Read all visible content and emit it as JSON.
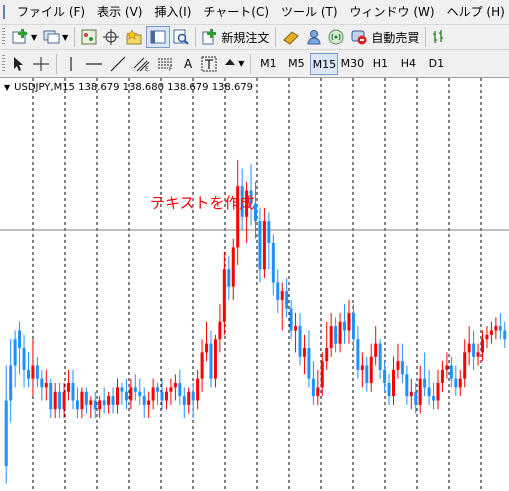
{
  "menu": {
    "items": [
      "ファイル (F)",
      "表示 (V)",
      "挿入(I)",
      "チャート(C)",
      "ツール (T)",
      "ウィンドウ (W)",
      "ヘルプ (H)"
    ]
  },
  "toolbar": {
    "new_order_label": "新規注文",
    "auto_trade_label": "自動売買"
  },
  "drawing_tools": {
    "text_tool_label": "A"
  },
  "timeframes": {
    "items": [
      "M1",
      "M5",
      "M15",
      "M30",
      "H1",
      "H4",
      "D1"
    ],
    "active": "M15"
  },
  "chart": {
    "header_text": "USDJPY,M15  138.679 138.680 138.679 138.679",
    "text_object": "テキストを作成",
    "colors": {
      "bull": "#ff0000",
      "bear": "#1e90ff",
      "grid": "#000000",
      "hline": "#808080"
    }
  },
  "chart_data": {
    "type": "candlestick",
    "symbol": "USDJPY",
    "timeframe": "M15",
    "grid": true,
    "scale_note": "relative price units, higher = higher price",
    "candles": [
      [
        290,
        306,
        260,
        252
      ],
      [
        306,
        318,
        290,
        280
      ],
      [
        318,
        322,
        306,
        296
      ],
      [
        322,
        326,
        314,
        302
      ],
      [
        314,
        320,
        304,
        296
      ],
      [
        304,
        312,
        300,
        296
      ],
      [
        300,
        318,
        306,
        292
      ],
      [
        306,
        310,
        300,
        296
      ],
      [
        300,
        304,
        296,
        290
      ],
      [
        296,
        304,
        298,
        290
      ],
      [
        298,
        300,
        286,
        282
      ],
      [
        286,
        298,
        294,
        282
      ],
      [
        294,
        298,
        286,
        282
      ],
      [
        286,
        298,
        294,
        282
      ],
      [
        294,
        304,
        298,
        290
      ],
      [
        298,
        304,
        290,
        286
      ],
      [
        290,
        296,
        286,
        282
      ],
      [
        286,
        296,
        294,
        282
      ],
      [
        294,
        296,
        288,
        284
      ],
      [
        288,
        292,
        290,
        282
      ],
      [
        290,
        294,
        286,
        282
      ],
      [
        286,
        292,
        290,
        282
      ],
      [
        290,
        296,
        288,
        284
      ],
      [
        288,
        294,
        292,
        284
      ],
      [
        292,
        296,
        288,
        284
      ],
      [
        288,
        300,
        296,
        284
      ],
      [
        296,
        298,
        294,
        288
      ],
      [
        294,
        300,
        290,
        286
      ],
      [
        290,
        300,
        296,
        286
      ],
      [
        296,
        302,
        294,
        290
      ],
      [
        294,
        300,
        292,
        288
      ],
      [
        292,
        296,
        288,
        282
      ],
      [
        288,
        294,
        290,
        282
      ],
      [
        290,
        300,
        296,
        286
      ],
      [
        296,
        298,
        294,
        288
      ],
      [
        294,
        300,
        290,
        286
      ],
      [
        290,
        296,
        294,
        286
      ],
      [
        294,
        300,
        296,
        288
      ],
      [
        296,
        302,
        298,
        290
      ],
      [
        298,
        304,
        292,
        288
      ],
      [
        292,
        296,
        288,
        282
      ],
      [
        288,
        296,
        294,
        284
      ],
      [
        294,
        298,
        290,
        282
      ],
      [
        290,
        304,
        300,
        286
      ],
      [
        300,
        318,
        312,
        294
      ],
      [
        312,
        326,
        316,
        308
      ],
      [
        316,
        322,
        300,
        296
      ],
      [
        300,
        320,
        318,
        296
      ],
      [
        318,
        334,
        326,
        312
      ],
      [
        326,
        358,
        350,
        320
      ],
      [
        350,
        356,
        342,
        336
      ],
      [
        342,
        364,
        360,
        336
      ],
      [
        360,
        400,
        388,
        352
      ],
      [
        388,
        396,
        374,
        368
      ],
      [
        374,
        390,
        386,
        362
      ],
      [
        386,
        398,
        380,
        370
      ],
      [
        380,
        390,
        372,
        364
      ],
      [
        372,
        378,
        350,
        344
      ],
      [
        350,
        378,
        372,
        346
      ],
      [
        372,
        376,
        362,
        350
      ],
      [
        362,
        366,
        344,
        338
      ],
      [
        344,
        350,
        336,
        330
      ],
      [
        336,
        344,
        340,
        322
      ],
      [
        340,
        346,
        332,
        328
      ],
      [
        332,
        336,
        322,
        318
      ],
      [
        322,
        330,
        324,
        312
      ],
      [
        324,
        330,
        310,
        306
      ],
      [
        310,
        320,
        314,
        302
      ],
      [
        314,
        322,
        300,
        296
      ],
      [
        300,
        308,
        292,
        288
      ],
      [
        292,
        304,
        296,
        288
      ],
      [
        296,
        312,
        308,
        292
      ],
      [
        308,
        326,
        314,
        304
      ],
      [
        314,
        330,
        324,
        310
      ],
      [
        324,
        328,
        316,
        312
      ],
      [
        316,
        330,
        326,
        312
      ],
      [
        326,
        334,
        322,
        316
      ],
      [
        322,
        336,
        330,
        316
      ],
      [
        330,
        334,
        318,
        314
      ],
      [
        318,
        324,
        304,
        300
      ],
      [
        304,
        312,
        306,
        296
      ],
      [
        306,
        310,
        298,
        294
      ],
      [
        298,
        316,
        310,
        294
      ],
      [
        310,
        324,
        316,
        306
      ],
      [
        316,
        318,
        304,
        300
      ],
      [
        304,
        308,
        298,
        294
      ],
      [
        298,
        302,
        292,
        288
      ],
      [
        292,
        310,
        304,
        288
      ],
      [
        304,
        316,
        308,
        300
      ],
      [
        308,
        316,
        302,
        298
      ],
      [
        302,
        306,
        292,
        288
      ],
      [
        292,
        300,
        294,
        286
      ],
      [
        294,
        298,
        288,
        284
      ],
      [
        288,
        306,
        300,
        284
      ],
      [
        300,
        312,
        296,
        292
      ],
      [
        296,
        304,
        292,
        288
      ],
      [
        292,
        298,
        290,
        286
      ],
      [
        290,
        304,
        298,
        286
      ],
      [
        298,
        308,
        304,
        294
      ],
      [
        304,
        312,
        306,
        300
      ],
      [
        306,
        310,
        300,
        296
      ],
      [
        300,
        306,
        296,
        292
      ],
      [
        296,
        304,
        300,
        292
      ],
      [
        300,
        318,
        312,
        296
      ],
      [
        312,
        324,
        316,
        306
      ],
      [
        316,
        322,
        310,
        304
      ],
      [
        310,
        316,
        312,
        306
      ],
      [
        312,
        322,
        318,
        308
      ],
      [
        318,
        324,
        320,
        314
      ],
      [
        320,
        326,
        322,
        316
      ],
      [
        322,
        328,
        324,
        318
      ],
      [
        324,
        330,
        322,
        318
      ],
      [
        322,
        326,
        318,
        314
      ]
    ]
  }
}
